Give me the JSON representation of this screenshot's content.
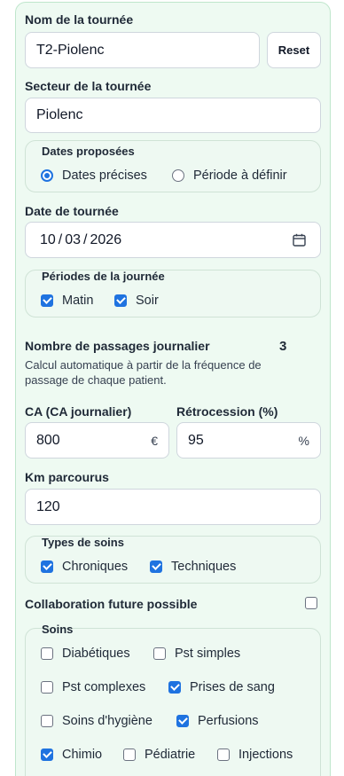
{
  "tournee": {
    "name_label": "Nom de la tournée",
    "name_value": "T2-Piolenc",
    "reset_label": "Reset",
    "sector_label": "Secteur de la tournée",
    "sector_value": "Piolenc"
  },
  "dates": {
    "legend": "Dates proposées",
    "options": [
      {
        "label": "Dates précises",
        "selected": true
      },
      {
        "label": "Période à définir",
        "selected": false
      }
    ],
    "date_label": "Date de tournée",
    "date_day": "10",
    "date_sep": "/",
    "date_month": "03",
    "date_year": "2026",
    "calendar_icon": "calendar-icon"
  },
  "periodes": {
    "legend": "Périodes de la journée",
    "items": [
      {
        "label": "Matin",
        "checked": true
      },
      {
        "label": "Soir",
        "checked": true
      }
    ]
  },
  "passages": {
    "label": "Nombre de passages journalier",
    "value": "3",
    "help": "Calcul automatique à partir de la fréquence de passage de chaque patient."
  },
  "finance": {
    "ca_label": "CA (CA journalier)",
    "ca_value": "800",
    "ca_suffix": "€",
    "retro_label": "Rétrocession (%)",
    "retro_value": "95",
    "retro_suffix": "%",
    "km_label": "Km parcourus",
    "km_value": "120"
  },
  "types": {
    "legend": "Types de soins",
    "items": [
      {
        "label": "Chroniques",
        "checked": true
      },
      {
        "label": "Techniques",
        "checked": true
      }
    ]
  },
  "collaboration": {
    "label": "Collaboration future possible",
    "checked": false
  },
  "soins": {
    "legend": "Soins",
    "items": [
      {
        "label": "Diabétiques",
        "checked": false
      },
      {
        "label": "Pst simples",
        "checked": false
      },
      {
        "label": "Pst complexes",
        "checked": false
      },
      {
        "label": "Prises de sang",
        "checked": true
      },
      {
        "label": "Soins d'hygiène",
        "checked": false
      },
      {
        "label": "Perfusions",
        "checked": true
      },
      {
        "label": "Chimio",
        "checked": true
      },
      {
        "label": "Pédiatrie",
        "checked": false
      },
      {
        "label": "Injections",
        "checked": false
      }
    ]
  },
  "colors": {
    "accent": "#1f73e0",
    "panel_bg": "#eefaf2",
    "panel_border": "#bfe6cc"
  }
}
